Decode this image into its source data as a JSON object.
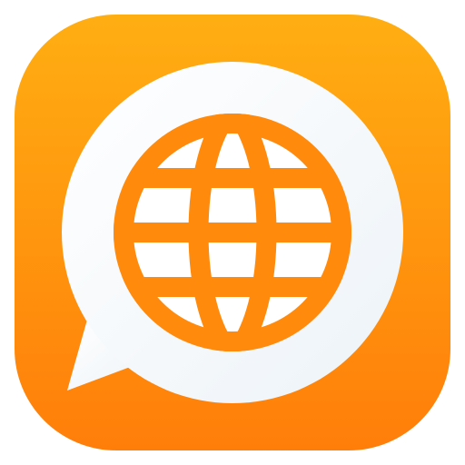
{
  "app_icon": {
    "name": "globe-chat",
    "icon": "globe-in-speech-bubble-icon",
    "colors": {
      "background_top": "#FFAE12",
      "background_bottom": "#FF7E0A",
      "bubble_fill": "#FFFFFF",
      "bubble_shade": "#EDF3F8",
      "globe_stroke": "#FF8A0C"
    }
  }
}
